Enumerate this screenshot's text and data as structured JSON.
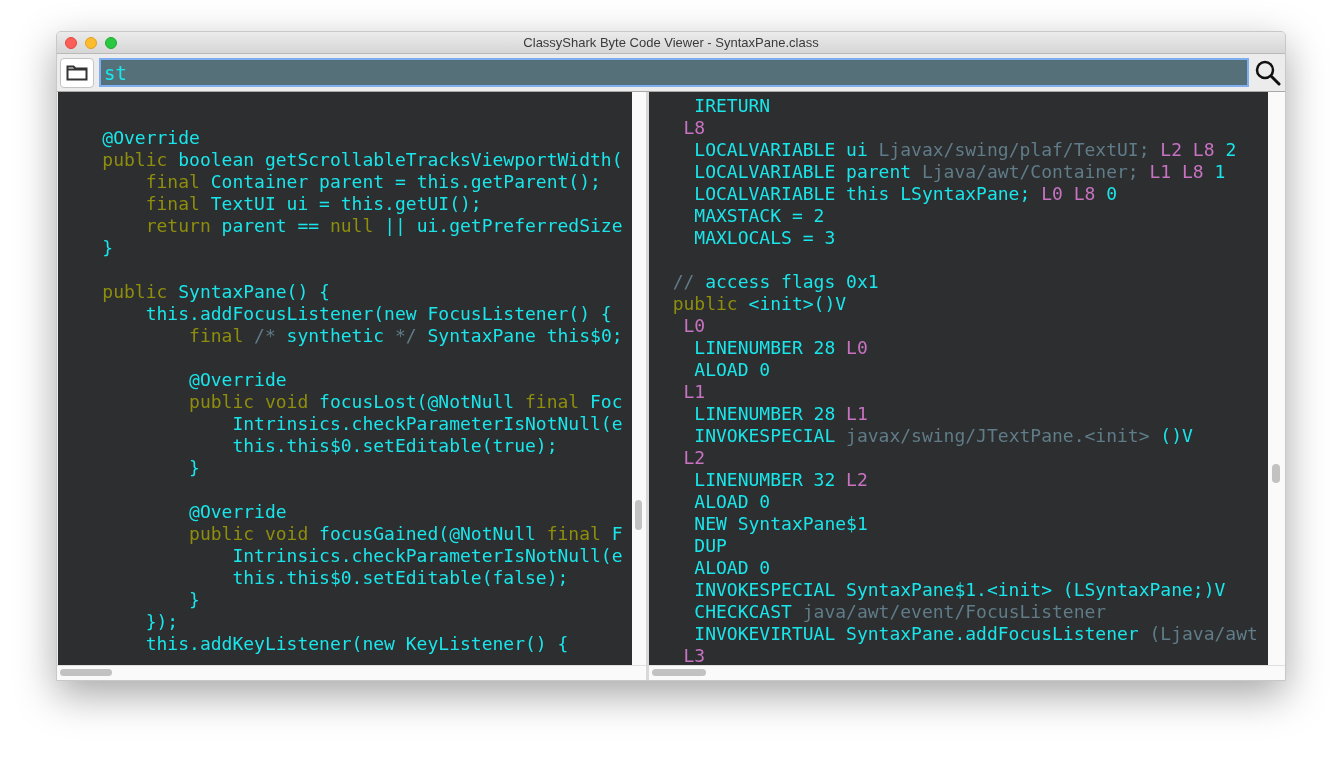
{
  "window": {
    "title": "ClassyShark Byte Code Viewer - SyntaxPane.class"
  },
  "search": {
    "value": "st"
  },
  "source_pane": {
    "lines": [
      {
        "segments": [
          {
            "kind": "ident",
            "text": "    @Override"
          }
        ]
      },
      {
        "segments": [
          {
            "kind": "keyword",
            "text": "    public"
          },
          {
            "kind": "ident",
            "text": " boolean getScrollableTracksViewportWidth("
          }
        ]
      },
      {
        "segments": [
          {
            "kind": "keyword",
            "text": "        final"
          },
          {
            "kind": "ident",
            "text": " Container parent = this.getParent();"
          }
        ]
      },
      {
        "segments": [
          {
            "kind": "keyword",
            "text": "        final"
          },
          {
            "kind": "ident",
            "text": " TextUI ui = this.getUI();"
          }
        ]
      },
      {
        "segments": [
          {
            "kind": "keyword",
            "text": "        return"
          },
          {
            "kind": "ident",
            "text": " parent == "
          },
          {
            "kind": "keyword",
            "text": "null"
          },
          {
            "kind": "ident",
            "text": " || ui.getPreferredSize"
          }
        ]
      },
      {
        "segments": [
          {
            "kind": "ident",
            "text": "    }"
          }
        ]
      },
      {
        "kind": "blank"
      },
      {
        "segments": [
          {
            "kind": "keyword",
            "text": "    public"
          },
          {
            "kind": "ident",
            "text": " SyntaxPane() {"
          }
        ]
      },
      {
        "segments": [
          {
            "kind": "ident",
            "text": "        this.addFocusListener(new FocusListener() {"
          }
        ]
      },
      {
        "segments": [
          {
            "kind": "keyword",
            "text": "            final"
          },
          {
            "kind": "comment",
            "text": " /*"
          },
          {
            "kind": "ident",
            "text": " synthetic "
          },
          {
            "kind": "comment",
            "text": "*/"
          },
          {
            "kind": "ident",
            "text": " SyntaxPane this$0;"
          }
        ]
      },
      {
        "kind": "blank"
      },
      {
        "segments": [
          {
            "kind": "ident",
            "text": "            @Override"
          }
        ]
      },
      {
        "segments": [
          {
            "kind": "keyword",
            "text": "            public void"
          },
          {
            "kind": "ident",
            "text": " focusLost(@NotNull "
          },
          {
            "kind": "keyword",
            "text": "final"
          },
          {
            "kind": "ident",
            "text": " Foc"
          }
        ]
      },
      {
        "segments": [
          {
            "kind": "ident",
            "text": "                Intrinsics.checkParameterIsNotNull(e"
          }
        ]
      },
      {
        "segments": [
          {
            "kind": "ident",
            "text": "                this.this$0.setEditable(true);"
          }
        ]
      },
      {
        "segments": [
          {
            "kind": "ident",
            "text": "            }"
          }
        ]
      },
      {
        "kind": "blank"
      },
      {
        "segments": [
          {
            "kind": "ident",
            "text": "            @Override"
          }
        ]
      },
      {
        "segments": [
          {
            "kind": "keyword",
            "text": "            public void"
          },
          {
            "kind": "ident",
            "text": " focusGained(@NotNull "
          },
          {
            "kind": "keyword",
            "text": "final"
          },
          {
            "kind": "ident",
            "text": " F"
          }
        ]
      },
      {
        "segments": [
          {
            "kind": "ident",
            "text": "                Intrinsics.checkParameterIsNotNull(e"
          }
        ]
      },
      {
        "segments": [
          {
            "kind": "ident",
            "text": "                this.this$0.setEditable(false);"
          }
        ]
      },
      {
        "segments": [
          {
            "kind": "ident",
            "text": "            }"
          }
        ]
      },
      {
        "segments": [
          {
            "kind": "ident",
            "text": "        });"
          }
        ]
      },
      {
        "segments": [
          {
            "kind": "ident",
            "text": "        this.addKeyListener(new KeyListener() {"
          }
        ]
      }
    ]
  },
  "bytecode_pane": {
    "lines": [
      {
        "segments": [
          {
            "kind": "ident",
            "text": "    IRETURN"
          }
        ]
      },
      {
        "segments": [
          {
            "kind": "label",
            "text": "   L8"
          }
        ]
      },
      {
        "segments": [
          {
            "kind": "ident",
            "text": "    LOCALVARIABLE ui"
          },
          {
            "kind": "comment",
            "text": " Ljavax/swing/plaf/TextUI;"
          },
          {
            "kind": "label",
            "text": " L2 L8"
          },
          {
            "kind": "ident",
            "text": " 2"
          }
        ]
      },
      {
        "segments": [
          {
            "kind": "ident",
            "text": "    LOCALVARIABLE parent"
          },
          {
            "kind": "comment",
            "text": " Ljava/awt/Container;"
          },
          {
            "kind": "label",
            "text": " L1 L8"
          },
          {
            "kind": "ident",
            "text": " 1"
          }
        ]
      },
      {
        "segments": [
          {
            "kind": "ident",
            "text": "    LOCALVARIABLE this LSyntaxPane;"
          },
          {
            "kind": "label",
            "text": " L0 L8"
          },
          {
            "kind": "ident",
            "text": " 0"
          }
        ]
      },
      {
        "segments": [
          {
            "kind": "ident",
            "text": "    MAXSTACK = 2"
          }
        ]
      },
      {
        "segments": [
          {
            "kind": "ident",
            "text": "    MAXLOCALS = 3"
          }
        ]
      },
      {
        "kind": "blank"
      },
      {
        "segments": [
          {
            "kind": "comment",
            "text": "  //"
          },
          {
            "kind": "ident",
            "text": " access flags 0x1"
          }
        ]
      },
      {
        "segments": [
          {
            "kind": "keyword",
            "text": "  public"
          },
          {
            "kind": "ident",
            "text": " <init>()V"
          }
        ]
      },
      {
        "segments": [
          {
            "kind": "label",
            "text": "   L0"
          }
        ]
      },
      {
        "segments": [
          {
            "kind": "ident",
            "text": "    LINENUMBER 28"
          },
          {
            "kind": "label",
            "text": " L0"
          }
        ]
      },
      {
        "segments": [
          {
            "kind": "ident",
            "text": "    ALOAD 0"
          }
        ]
      },
      {
        "segments": [
          {
            "kind": "label",
            "text": "   L1"
          }
        ]
      },
      {
        "segments": [
          {
            "kind": "ident",
            "text": "    LINENUMBER 28"
          },
          {
            "kind": "label",
            "text": " L1"
          }
        ]
      },
      {
        "segments": [
          {
            "kind": "ident",
            "text": "    INVOKESPECIAL"
          },
          {
            "kind": "comment",
            "text": " javax/swing/JTextPane.<init>"
          },
          {
            "kind": "ident",
            "text": " ()V"
          }
        ]
      },
      {
        "segments": [
          {
            "kind": "label",
            "text": "   L2"
          }
        ]
      },
      {
        "segments": [
          {
            "kind": "ident",
            "text": "    LINENUMBER 32"
          },
          {
            "kind": "label",
            "text": " L2"
          }
        ]
      },
      {
        "segments": [
          {
            "kind": "ident",
            "text": "    ALOAD 0"
          }
        ]
      },
      {
        "segments": [
          {
            "kind": "ident",
            "text": "    NEW SyntaxPane$1"
          }
        ]
      },
      {
        "segments": [
          {
            "kind": "ident",
            "text": "    DUP"
          }
        ]
      },
      {
        "segments": [
          {
            "kind": "ident",
            "text": "    ALOAD 0"
          }
        ]
      },
      {
        "segments": [
          {
            "kind": "ident",
            "text": "    INVOKESPECIAL SyntaxPane$1.<init> (LSyntaxPane;)V"
          }
        ]
      },
      {
        "segments": [
          {
            "kind": "ident",
            "text": "    CHECKCAST"
          },
          {
            "kind": "comment",
            "text": " java/awt/event/FocusListener"
          }
        ]
      },
      {
        "segments": [
          {
            "kind": "ident",
            "text": "    INVOKEVIRTUAL SyntaxPane.addFocusListener"
          },
          {
            "kind": "comment",
            "text": " (Ljava/awt"
          }
        ]
      },
      {
        "segments": [
          {
            "kind": "label",
            "text": "   L3"
          }
        ]
      }
    ]
  }
}
